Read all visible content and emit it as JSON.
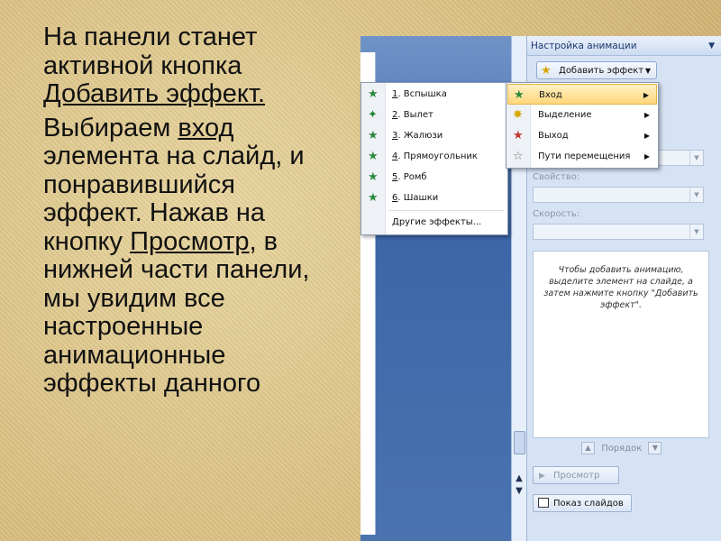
{
  "slide": {
    "para1": {
      "line1": "На панели станет",
      "line2": "активной кнопка",
      "add_effect": "Добавить эффект."
    },
    "para2": {
      "part1": "Выбираем ",
      "vhod": "вход",
      "part2": " элемента на слайд, и понравившийся эффект. Нажав на кнопку ",
      "prosmotr": "Просмотр",
      "part3": ", в нижней части панели, мы увидим все настроенные анимационные эффекты данного"
    }
  },
  "panel": {
    "title": "Настройка анимации",
    "add_effect_button": "Добавить эффект",
    "property_label": "Свойство:",
    "speed_label": "Скорость:",
    "hint": "Чтобы добавить анимацию, выделите элемент на слайде, а затем нажмите кнопку \"Добавить эффект\".",
    "order_label": "Порядок",
    "preview_button": "Просмотр",
    "slideshow_button": "Показ слайдов"
  },
  "category_menu": [
    {
      "label": "Вход",
      "icon": "entrance-star-icon",
      "color": "#2b8a3e"
    },
    {
      "label": "Выделение",
      "icon": "emphasis-star-icon",
      "color": "#d6a800"
    },
    {
      "label": "Выход",
      "icon": "exit-star-icon",
      "color": "#c0392b"
    },
    {
      "label": "Пути перемещения",
      "icon": "motion-path-star-icon",
      "color": "#777777"
    }
  ],
  "effects_menu": {
    "items": [
      {
        "num": "1",
        "label": ". Вспышка"
      },
      {
        "num": "2",
        "label": ". Вылет"
      },
      {
        "num": "3",
        "label": ". Жалюзи"
      },
      {
        "num": "4",
        "label": ". Прямоугольник"
      },
      {
        "num": "5",
        "label": ". Ромб"
      },
      {
        "num": "6",
        "label": ". Шашки"
      }
    ],
    "more": "Другие эффекты..."
  }
}
